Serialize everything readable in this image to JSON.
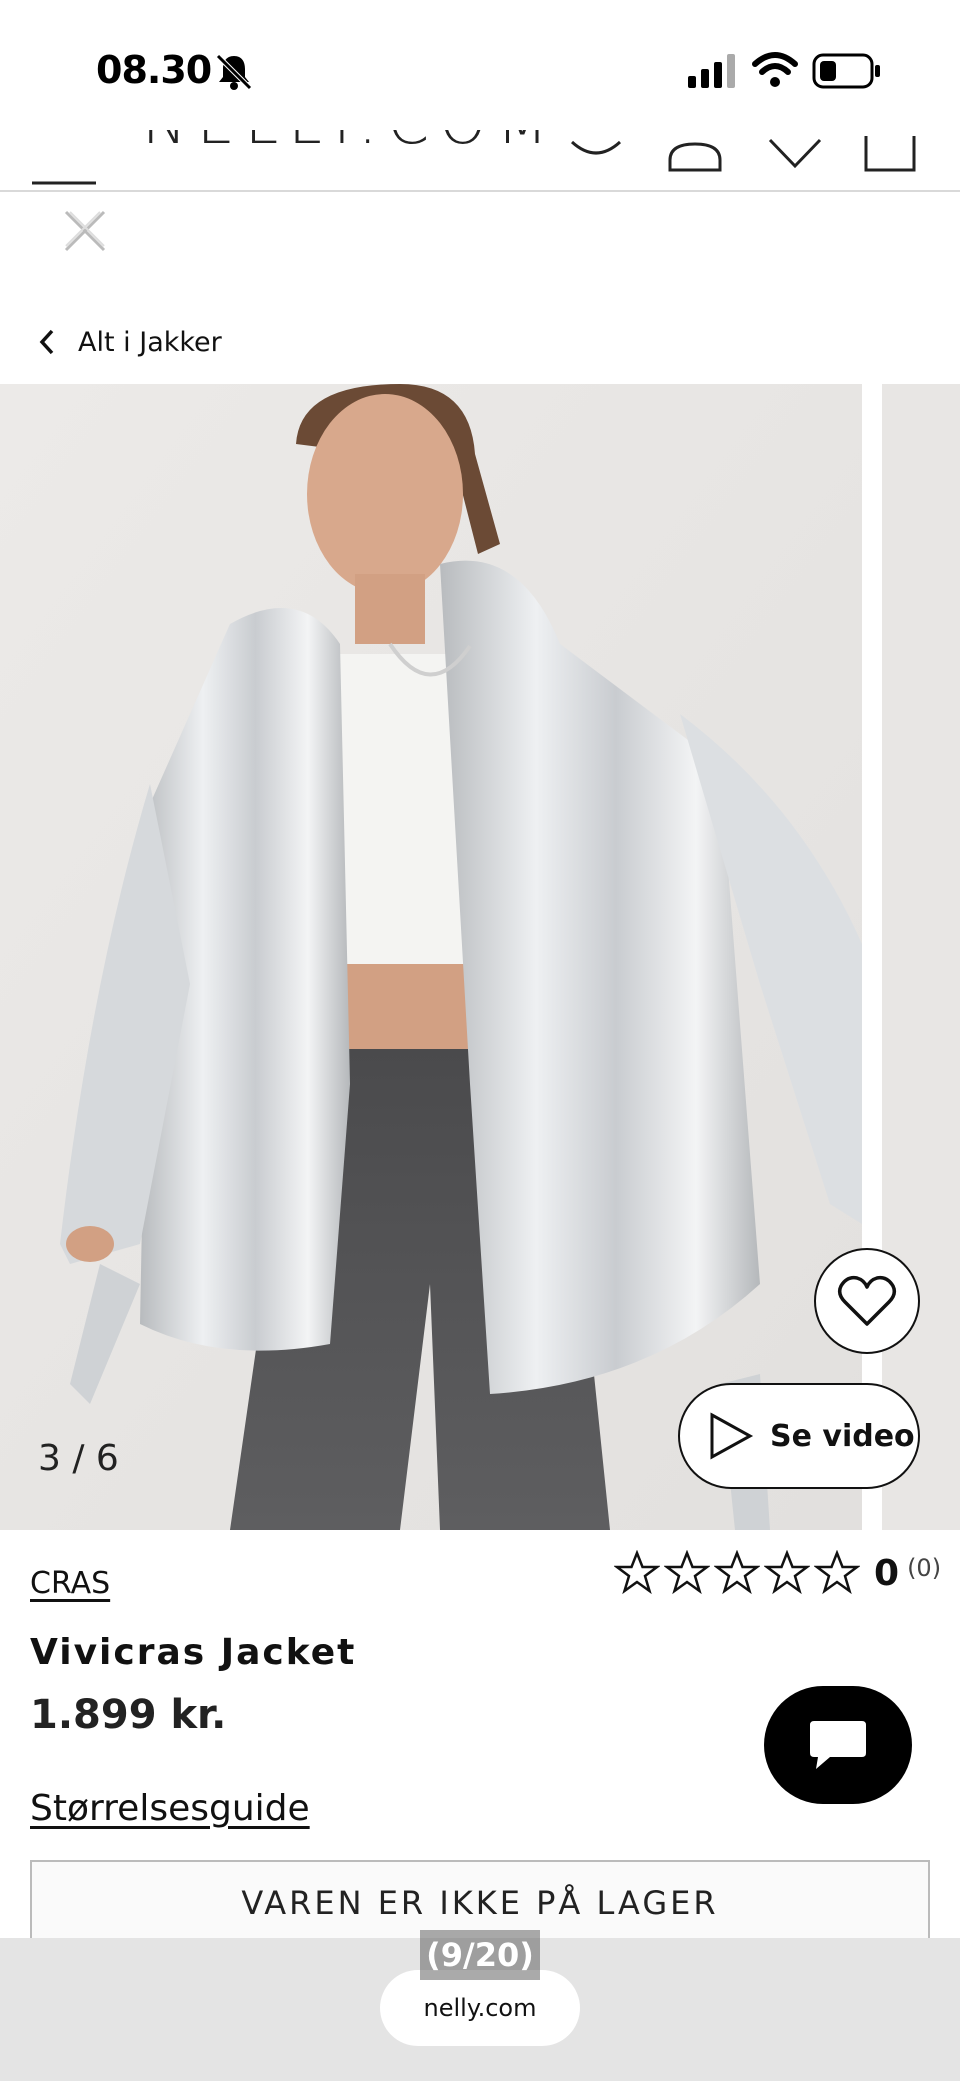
{
  "status_bar": {
    "time": "08.30",
    "icons": [
      "bell-muted-icon",
      "cellular-signal-icon",
      "wifi-icon",
      "battery-icon"
    ]
  },
  "header": {
    "logo": "NELLY.COM",
    "icons": [
      "menu-icon",
      "search-icon",
      "user-icon",
      "heart-icon",
      "bag-icon"
    ]
  },
  "breadcrumb": {
    "label": "Alt i Jakker"
  },
  "gallery": {
    "counter": "3 / 6",
    "video_label": "Se video"
  },
  "product": {
    "brand": "CRAS",
    "title": "Vivicras Jacket",
    "price": "1.899 kr.",
    "rating_value": "0",
    "rating_count": "(0)",
    "rating_stars": 0,
    "size_guide": "Størrelsesguide",
    "stock_status": "VAREN ER IKKE PÅ LAGER"
  },
  "browser": {
    "url": "nelly.com",
    "page_indicator": "(9/20)"
  },
  "colors": {
    "background": "#ffffff",
    "text": "#111111",
    "browser_bar": "#e4e4e4",
    "chat_button": "#000000"
  }
}
